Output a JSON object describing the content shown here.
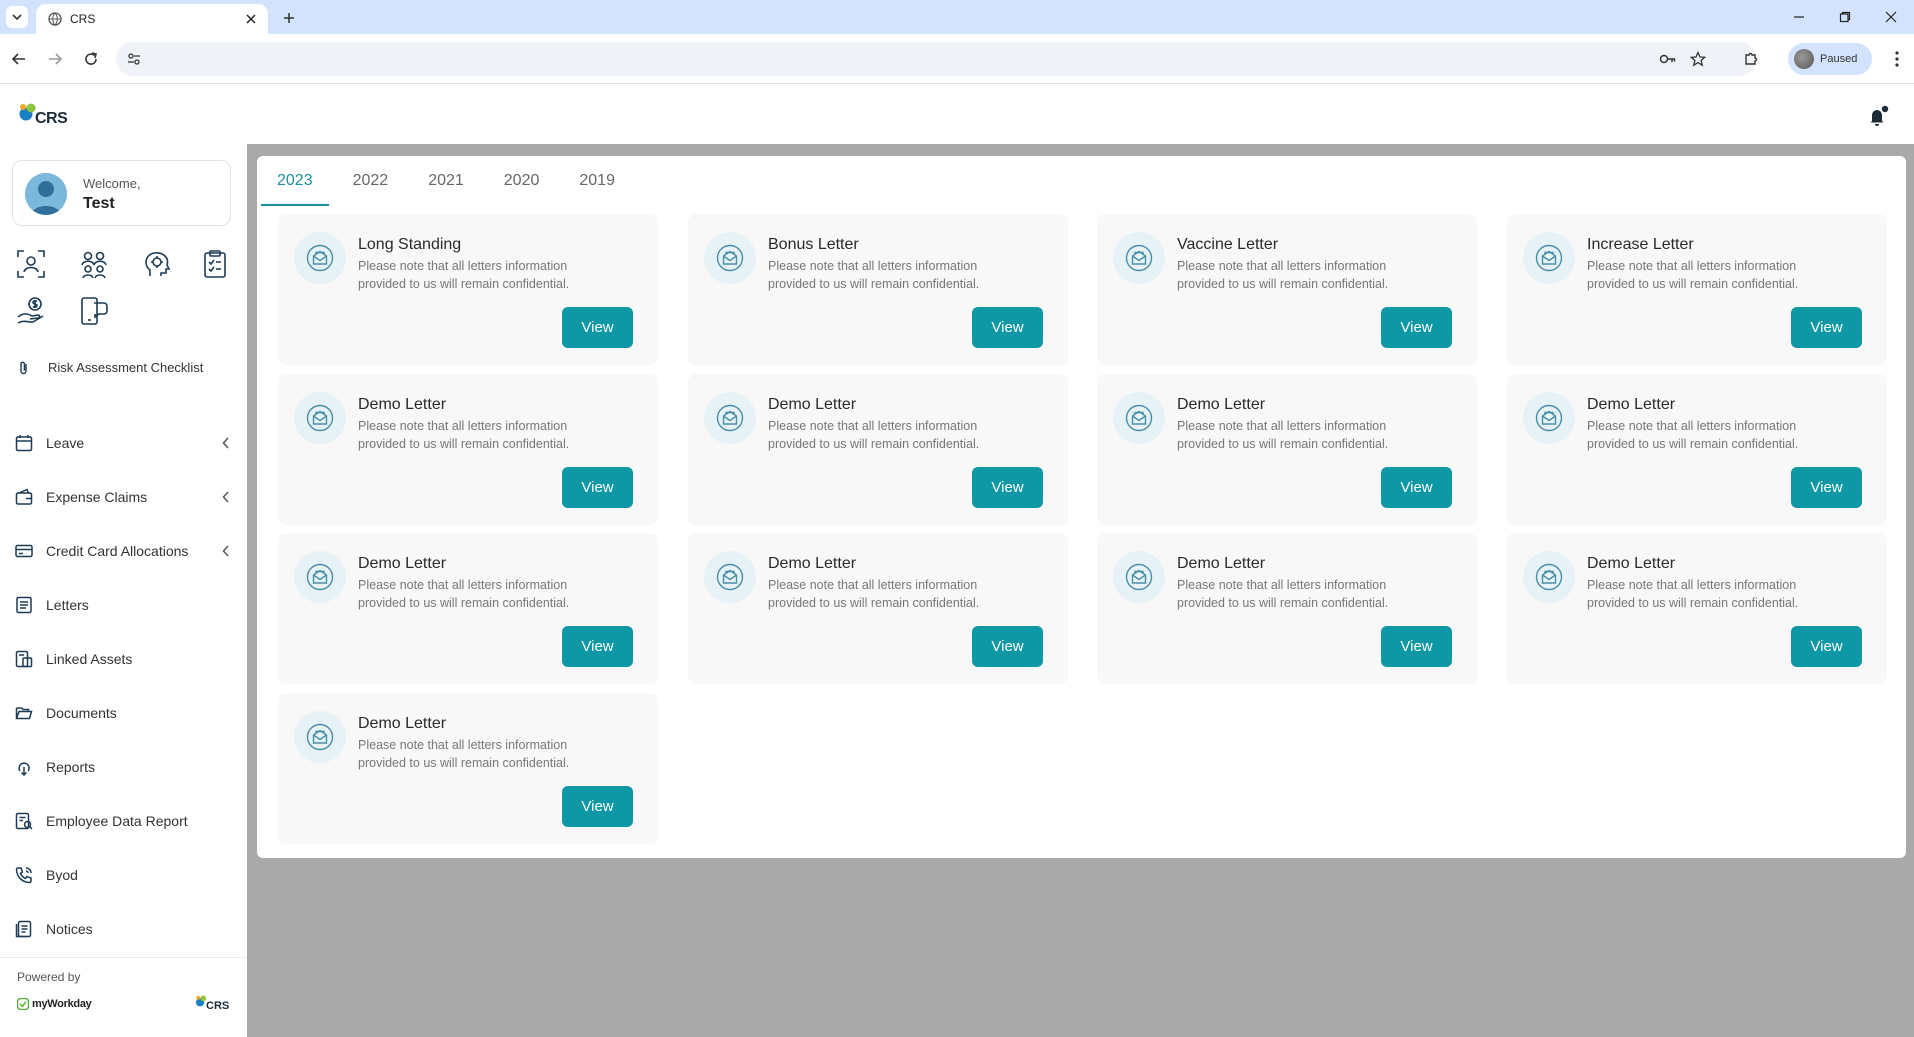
{
  "browser": {
    "tab_title": "CRS",
    "profile_label": "Paused"
  },
  "app": {
    "logo_text": "CRS"
  },
  "sidebar": {
    "welcome_label": "Welcome,",
    "user_name": "Test",
    "quick_icons": [
      "face-scan-icon",
      "team-icon",
      "settings-head-icon",
      "clipboard-icon",
      "salary-hand-icon",
      "phone-chat-icon"
    ],
    "risk_label": "Risk Assessment Checklist",
    "nav_items": [
      {
        "label": "Leave",
        "icon": "calendar-icon",
        "has_chevron": true
      },
      {
        "label": "Expense Claims",
        "icon": "wallet-icon",
        "has_chevron": true
      },
      {
        "label": "Credit Card Allocations",
        "icon": "credit-card-icon",
        "has_chevron": true
      },
      {
        "label": "Letters",
        "icon": "letter-icon",
        "has_chevron": false
      },
      {
        "label": "Linked Assets",
        "icon": "asset-icon",
        "has_chevron": false
      },
      {
        "label": "Documents",
        "icon": "folder-icon",
        "has_chevron": false
      },
      {
        "label": "Reports",
        "icon": "report-icon",
        "has_chevron": false
      },
      {
        "label": "Employee Data Report",
        "icon": "data-report-icon",
        "has_chevron": false
      },
      {
        "label": "Byod",
        "icon": "byod-icon",
        "has_chevron": false
      },
      {
        "label": "Notices",
        "icon": "notice-icon",
        "has_chevron": false
      }
    ],
    "powered_by": "Powered by",
    "myworkday": "myWorkday",
    "footer_logo_text": "CRS"
  },
  "main": {
    "tabs": [
      {
        "label": "2023",
        "active": true
      },
      {
        "label": "2022",
        "active": false
      },
      {
        "label": "2021",
        "active": false
      },
      {
        "label": "2020",
        "active": false
      },
      {
        "label": "2019",
        "active": false
      }
    ],
    "view_label": "View",
    "letters": [
      {
        "title": "Long Standing",
        "desc": "Please note that all letters information provided to us will remain confidential."
      },
      {
        "title": "Bonus Letter",
        "desc": "Please note that all letters information provided to us will remain confidential."
      },
      {
        "title": "Vaccine Letter",
        "desc": "Please note that all letters information provided to us will remain confidential."
      },
      {
        "title": "Increase Letter",
        "desc": "Please note that all letters information provided to us will remain confidential."
      },
      {
        "title": "Demo Letter",
        "desc": "Please note that all letters information provided to us will remain confidential."
      },
      {
        "title": "Demo Letter",
        "desc": "Please note that all letters information provided to us will remain confidential."
      },
      {
        "title": "Demo Letter",
        "desc": "Please note that all letters information provided to us will remain confidential."
      },
      {
        "title": "Demo Letter",
        "desc": "Please note that all letters information provided to us will remain confidential."
      },
      {
        "title": "Demo Letter",
        "desc": "Please note that all letters information provided to us will remain confidential."
      },
      {
        "title": "Demo Letter",
        "desc": "Please note that all letters information provided to us will remain confidential."
      },
      {
        "title": "Demo Letter",
        "desc": "Please note that all letters information provided to us will remain confidential."
      },
      {
        "title": "Demo Letter",
        "desc": "Please note that all letters information provided to us will remain confidential."
      },
      {
        "title": "Demo Letter",
        "desc": "Please note that all letters information provided to us will remain confidential."
      }
    ]
  },
  "colors": {
    "accent": "#0e97a4",
    "tab_active": "#1b8ea0",
    "backdrop": "#a9a9a9"
  }
}
